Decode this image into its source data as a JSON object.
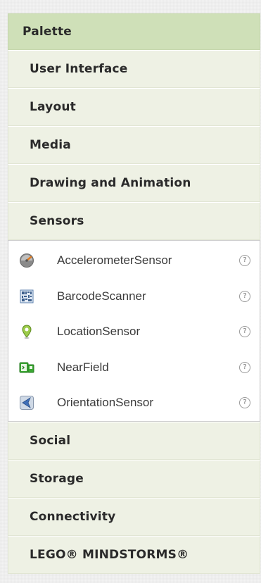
{
  "palette": {
    "title": "Palette",
    "categories_top": [
      {
        "label": "User Interface"
      },
      {
        "label": "Layout"
      },
      {
        "label": "Media"
      },
      {
        "label": "Drawing and Animation"
      },
      {
        "label": "Sensors"
      }
    ],
    "expanded_components": [
      {
        "label": "AccelerometerSensor",
        "icon": "accelerometer-icon",
        "help": "?"
      },
      {
        "label": "BarcodeScanner",
        "icon": "barcode-icon",
        "help": "?"
      },
      {
        "label": "LocationSensor",
        "icon": "location-pin-icon",
        "help": "?"
      },
      {
        "label": "NearField",
        "icon": "nearfield-icon",
        "help": "?"
      },
      {
        "label": "OrientationSensor",
        "icon": "orientation-icon",
        "help": "?"
      }
    ],
    "categories_bottom": [
      {
        "label": "Social"
      },
      {
        "label": "Storage"
      },
      {
        "label": "Connectivity"
      },
      {
        "label": "LEGO® MINDSTORMS®"
      }
    ]
  },
  "colors": {
    "header_bg": "#cfe0b8",
    "category_bg": "#eef1e4",
    "panel_bg": "#ffffff"
  }
}
